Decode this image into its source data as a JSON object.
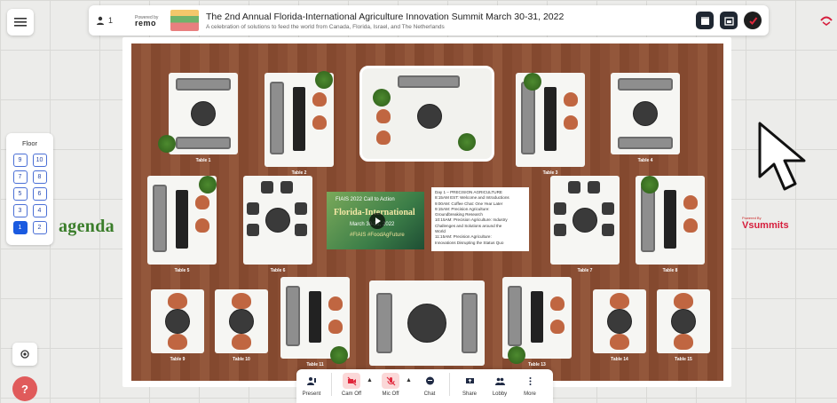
{
  "header": {
    "participant_count": "1",
    "powered_by": "Powered by",
    "powered_brand": "remo",
    "event_title": "The 2nd Annual Florida-International Agriculture Innovation Summit March 30-31, 2022",
    "event_subtitle": "A celebration of solutions to feed the world from Canada, Florida, Israel, and The Netherlands"
  },
  "floor_panel": {
    "label": "Floor",
    "floors": [
      "9",
      "10",
      "7",
      "8",
      "5",
      "6",
      "3",
      "4",
      "1",
      "2"
    ],
    "active": "1"
  },
  "map": {
    "agenda_text": "agenda",
    "tables": [
      {
        "label": "Table 1"
      },
      {
        "label": "Table 2"
      },
      {
        "label": "Table 3"
      },
      {
        "label": "Table 4"
      },
      {
        "label": "Table 5"
      },
      {
        "label": "Table 6"
      },
      {
        "label": "Table 7"
      },
      {
        "label": "Table 8"
      },
      {
        "label": "Table 9"
      },
      {
        "label": "Table 10"
      },
      {
        "label": "Table 11"
      },
      {
        "label": "Table 12"
      },
      {
        "label": "Table 13"
      },
      {
        "label": "Table 14"
      },
      {
        "label": "Table 15"
      }
    ],
    "slide": {
      "line1": "FIAIS 2022 Call to Action",
      "line2": "Florida-International",
      "line3": "Agriculture Innovation Summit",
      "line4": "March 30-31, 2022",
      "line5": "#FIAIS #FoodAgFuture"
    },
    "agenda_sheet": [
      "Day 1 – PRECISION AGRICULTURE",
      "8:15AM EST: Welcome and Introductions",
      "9:00AM: Coffee Chat: One Year Later",
      "9:15AM: Precision Agriculture:",
      "Groundbreaking Research",
      "10:15AM: Precision Agriculture: Industry",
      "Challenges and Solutions around the",
      "World",
      "11:15AM: Precision Agriculture:",
      "Innovations Disrupting the Status Quo"
    ],
    "sponsor_powered": "Powered By",
    "sponsor_name": "summits"
  },
  "toolbar": {
    "present": "Present",
    "cam": "Cam Off",
    "mic": "Mic Off",
    "chat": "Chat",
    "share": "Share",
    "lobby": "Lobby",
    "more": "More"
  },
  "help_label": "?",
  "colors": {
    "accent": "#1a5ae0",
    "alert": "#e05b5b",
    "wood": "#8a4e34"
  }
}
